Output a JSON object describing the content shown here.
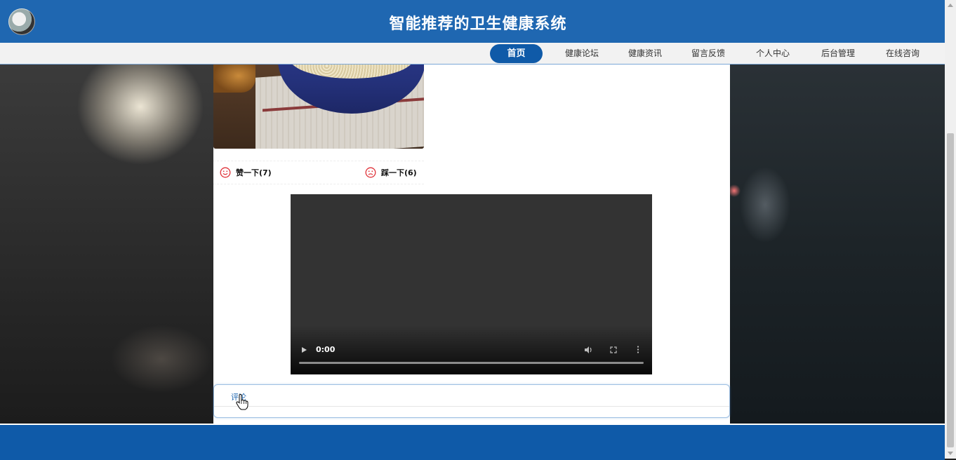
{
  "header": {
    "title": "智能推荐的卫生健康系统"
  },
  "nav": {
    "items": [
      {
        "label": "首页",
        "active": true
      },
      {
        "label": "健康论坛"
      },
      {
        "label": "健康资讯"
      },
      {
        "label": "留言反馈"
      },
      {
        "label": "个人中心"
      },
      {
        "label": "后台管理"
      },
      {
        "label": "在线咨询"
      }
    ]
  },
  "votes": {
    "like_label": "赞一下(7)",
    "dislike_label": "踩一下(6)"
  },
  "video": {
    "time": "0:00"
  },
  "comment": {
    "label": "评论"
  },
  "colors": {
    "brand": "#1f67b1",
    "footer": "#0f5aa8",
    "vote_icon": "#e0333a"
  }
}
